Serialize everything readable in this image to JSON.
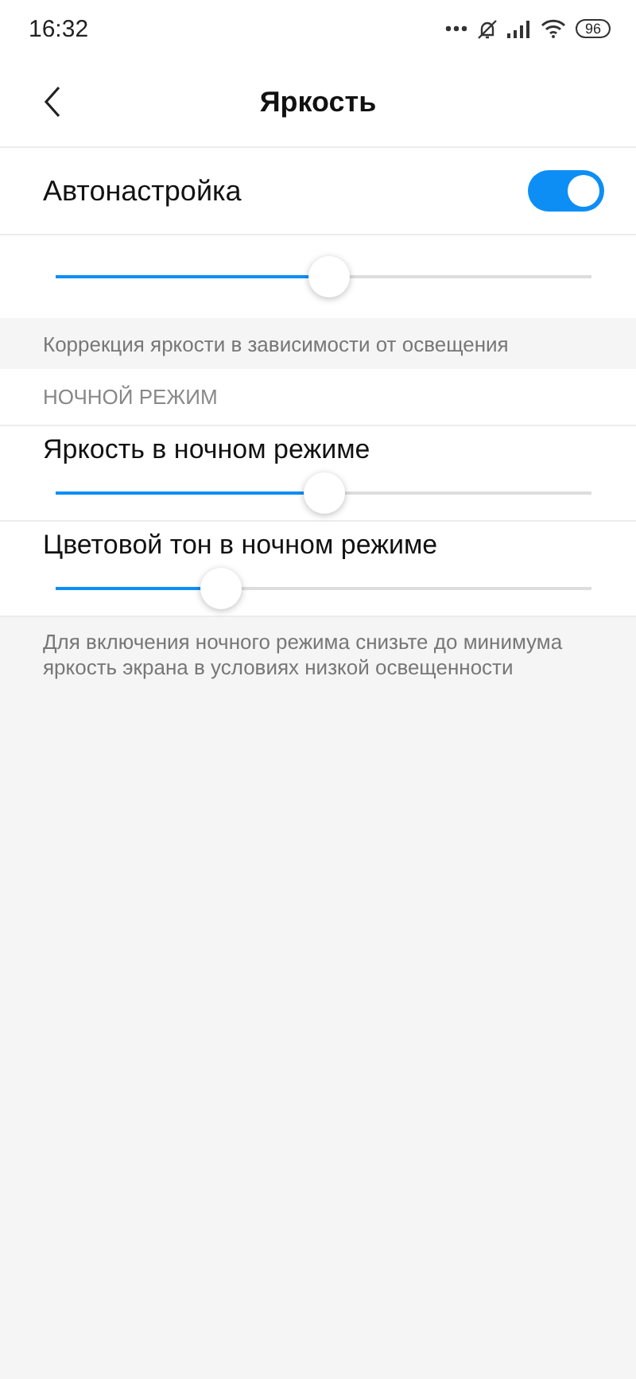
{
  "status_bar": {
    "time": "16:32",
    "battery": "96"
  },
  "header": {
    "title": "Яркость"
  },
  "auto": {
    "label": "Автонастройка",
    "on": true
  },
  "main_slider": {
    "level": 0.51
  },
  "auto_caption": "Коррекция яркости в зависимости от освещения",
  "night_section": {
    "title": "НОЧНОЙ РЕЖИМ",
    "items": [
      {
        "label": "Яркость в ночном режиме",
        "level": 0.5
      },
      {
        "label": "Цветовой тон в ночном режиме",
        "level": 0.31
      }
    ]
  },
  "footer_note": "Для включения ночного режима снизьте до минимума яркость экрана в условиях низкой освещенности"
}
